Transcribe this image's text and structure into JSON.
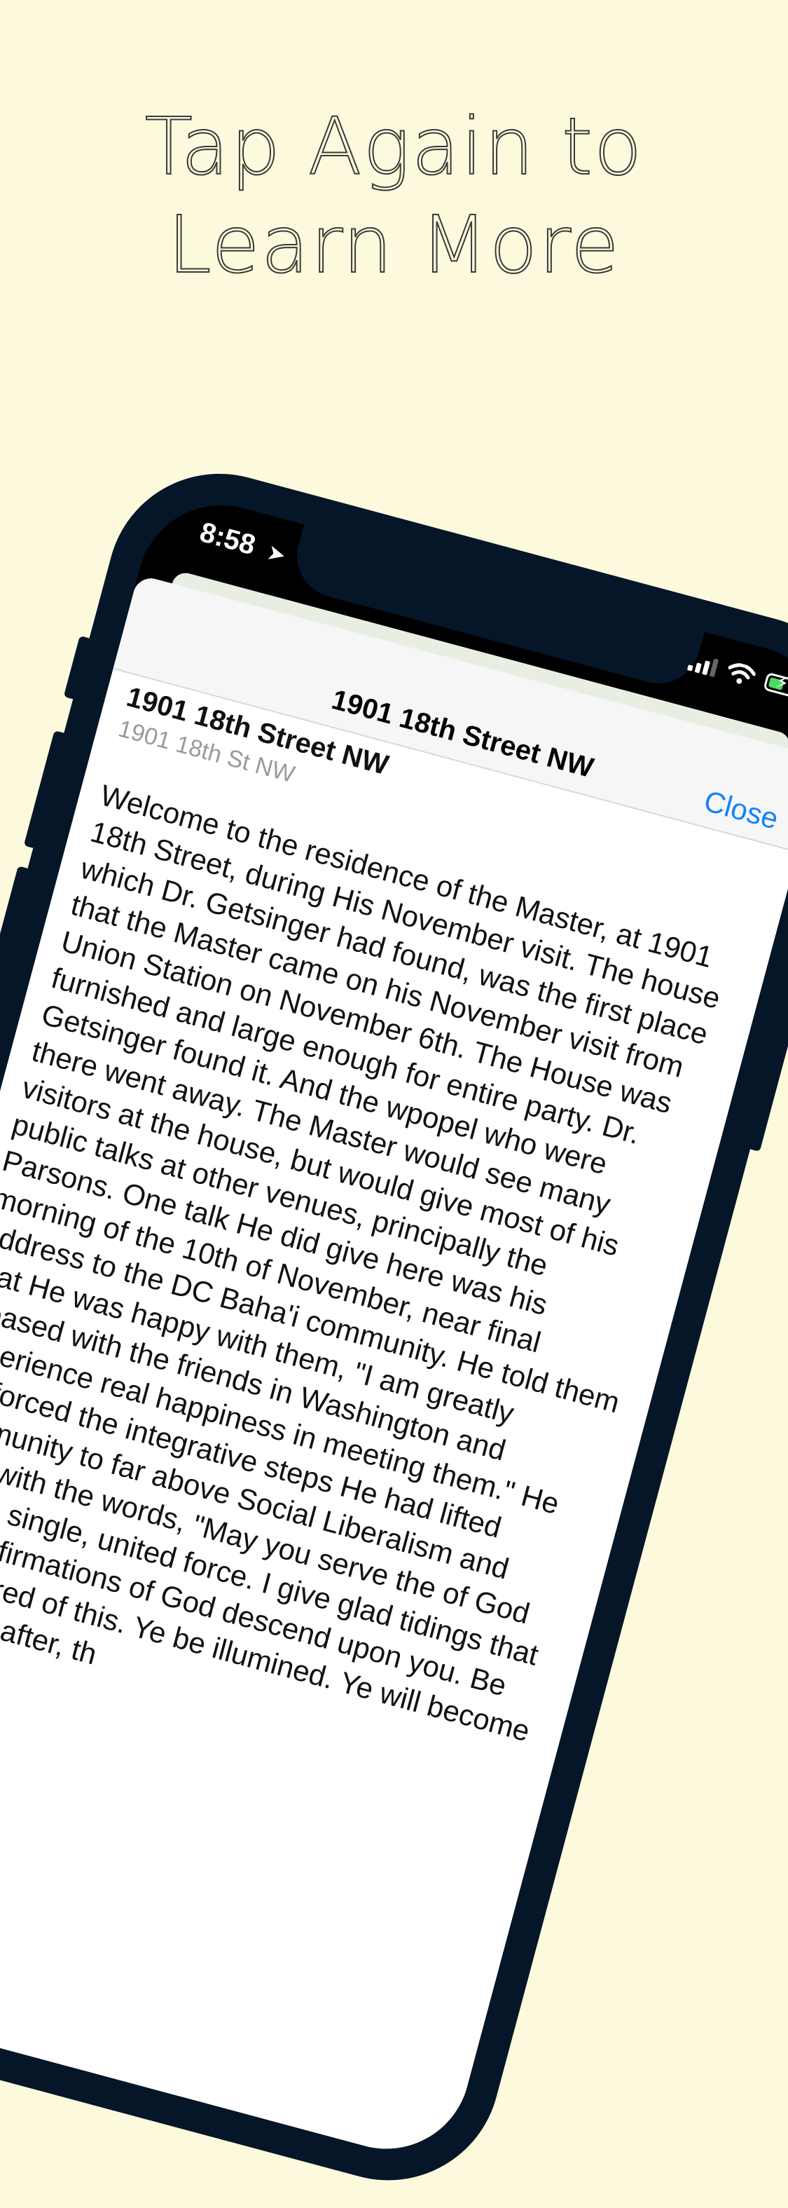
{
  "headline": {
    "line1": "Tap Again to",
    "line2": "Learn More"
  },
  "status_bar": {
    "time": "8:58",
    "location_icon": "location-arrow-icon",
    "signal_icon": "cellular-signal-icon",
    "wifi_icon": "wifi-icon",
    "battery_icon": "battery-charging-icon",
    "battery_level": 0.5,
    "battery_color": "#4cd964"
  },
  "sheet": {
    "nav_title": "1901 18th Street NW",
    "close_label": "Close",
    "place_name": "1901 18th Street NW",
    "place_address": "1901 18th St NW",
    "body": "Welcome to the residence of the Master, at 1901 18th Street, during His November visit. The house which Dr. Getsinger had found, was the first place that the Master came on his November visit from Union Station on November 6th. The House was furnished and large enough for entire party. Dr. Getsinger found it. And the wpopel who were there went away. The Master would see many visitors at the house, but would give most of his public talks at other venues, principally the Parsons. One talk He did give here was his morning of the 10th of November, near final address to the DC Baha'i community. He told them that He was happy with them, \"I am greatly pleased with the friends in Washington and experience real happiness in meeting them.\" He reinforced the integrative steps He had lifted community to far above Social Liberalism and race, with the words, \"May you serve the of God as one single, united force. I give glad tidings that the confirmations of God descend upon you. Be ye assured of this. Ye be illumined. Ye will become ...\" Thereafter, th"
  },
  "colors": {
    "background": "#fdf9dc",
    "phone_frame": "#041627",
    "link_blue": "#1582fb"
  }
}
